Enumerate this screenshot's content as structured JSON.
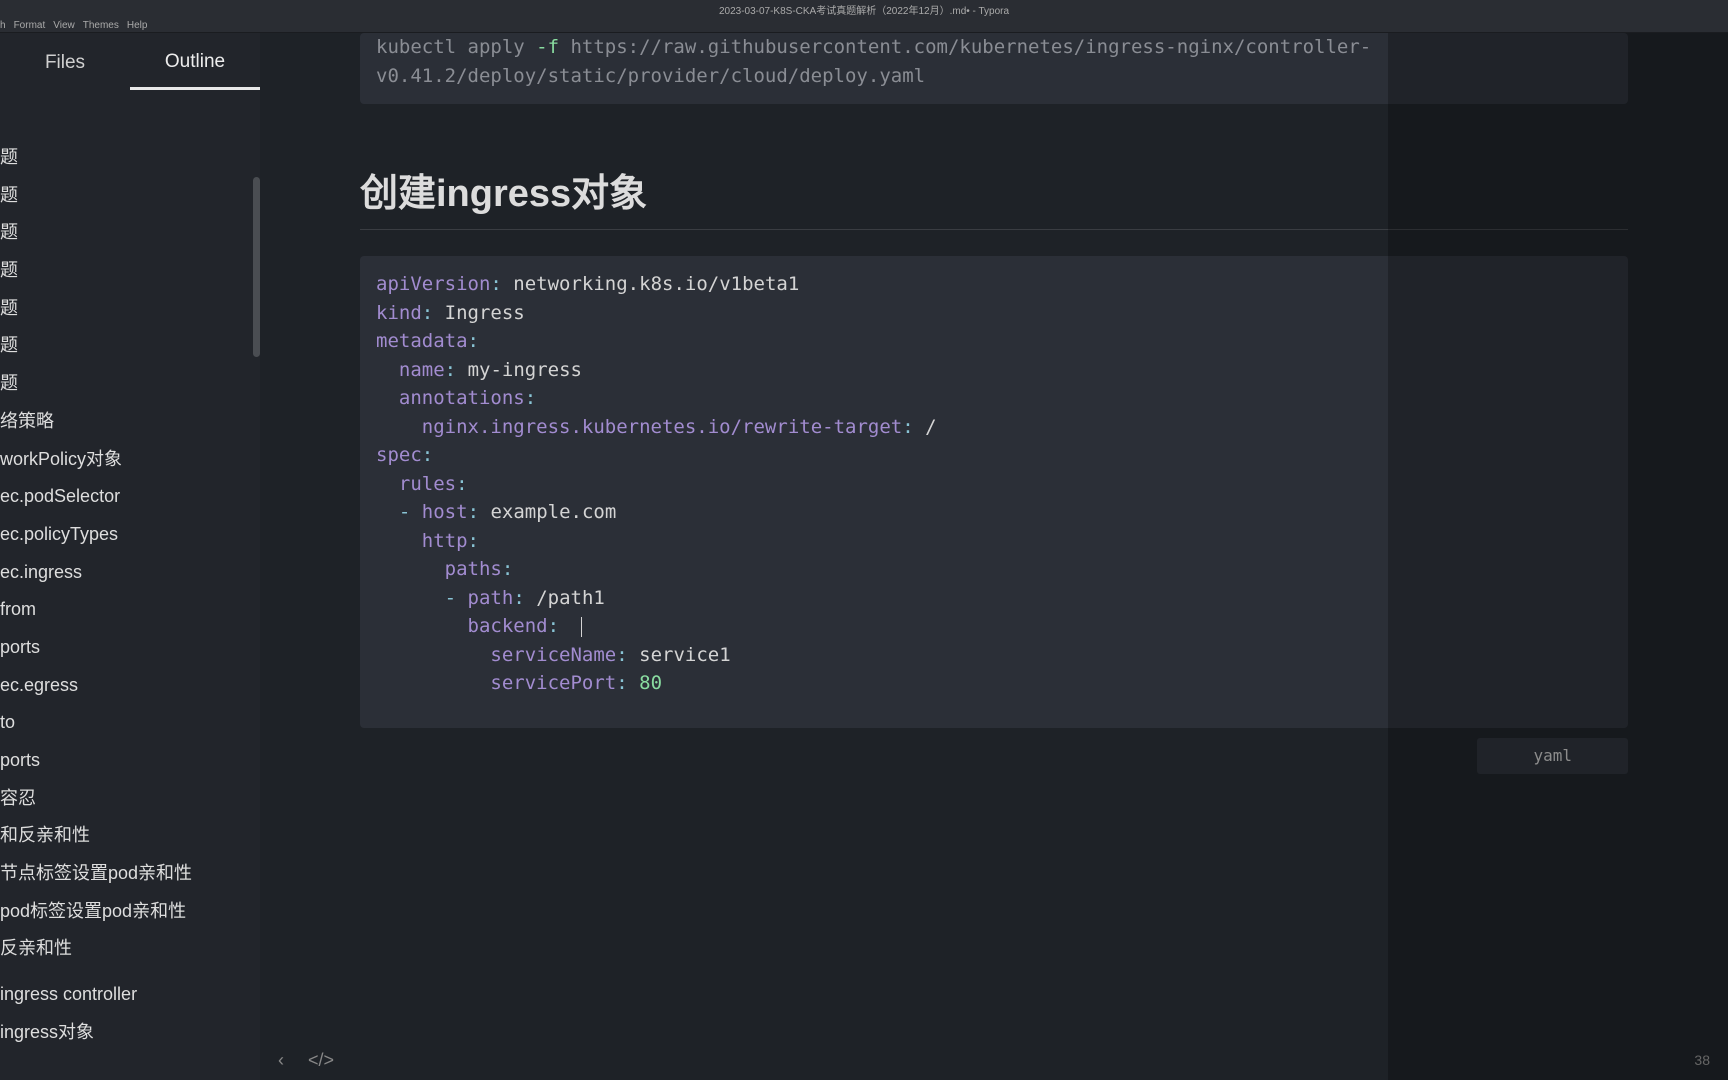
{
  "window_title": "2023-03-07-K8S-CKA考试真题解析（2022年12月）.md• - Typora",
  "menubar": {
    "items": [
      "h",
      "Format",
      "View",
      "Themes",
      "Help"
    ]
  },
  "sidebar": {
    "tabs": {
      "files": "Files",
      "outline": "Outline"
    },
    "outline_items": [
      "题",
      "题",
      "题",
      "题",
      "题",
      "题",
      "题",
      "络策略",
      "workPolicy对象",
      "ec.podSelector",
      "ec.policyTypes",
      "ec.ingress",
      "from",
      "ports",
      "ec.egress",
      "to",
      "ports",
      "容忍",
      "和反亲和性",
      "节点标签设置pod亲和性",
      "pod标签设置pod亲和性",
      "反亲和性",
      "",
      "ingress controller",
      "ingress对象"
    ]
  },
  "code_top": {
    "line1_cmd": "kubectl apply ",
    "line1_flag": "-f",
    "line1_url": " https://raw.githubusercontent.com/kubernetes/ingress-nginx/controller-",
    "line2": "v0.41.2/deploy/static/provider/cloud/deploy.yaml"
  },
  "heading": "创建ingress对象",
  "yaml": {
    "k_apiVersion": "apiVersion",
    "v_apiVersion": "networking.k8s.io/v1beta1",
    "k_kind": "kind",
    "v_kind": "Ingress",
    "k_metadata": "metadata",
    "k_name": "name",
    "v_name": "my-ingress",
    "k_annotations": "annotations",
    "k_rewrite": "nginx.ingress.kubernetes.io/rewrite-target",
    "v_rewrite": "/",
    "k_spec": "spec",
    "k_rules": "rules",
    "k_host": "host",
    "v_host": "example.com",
    "k_http": "http",
    "k_paths": "paths",
    "k_path": "path",
    "v_path": "/path1",
    "k_backend": "backend",
    "k_serviceName": "serviceName",
    "v_serviceName": "service1",
    "k_servicePort": "servicePort",
    "v_servicePort": "80"
  },
  "lang_label": "yaml",
  "status": {
    "word_count": "38"
  }
}
